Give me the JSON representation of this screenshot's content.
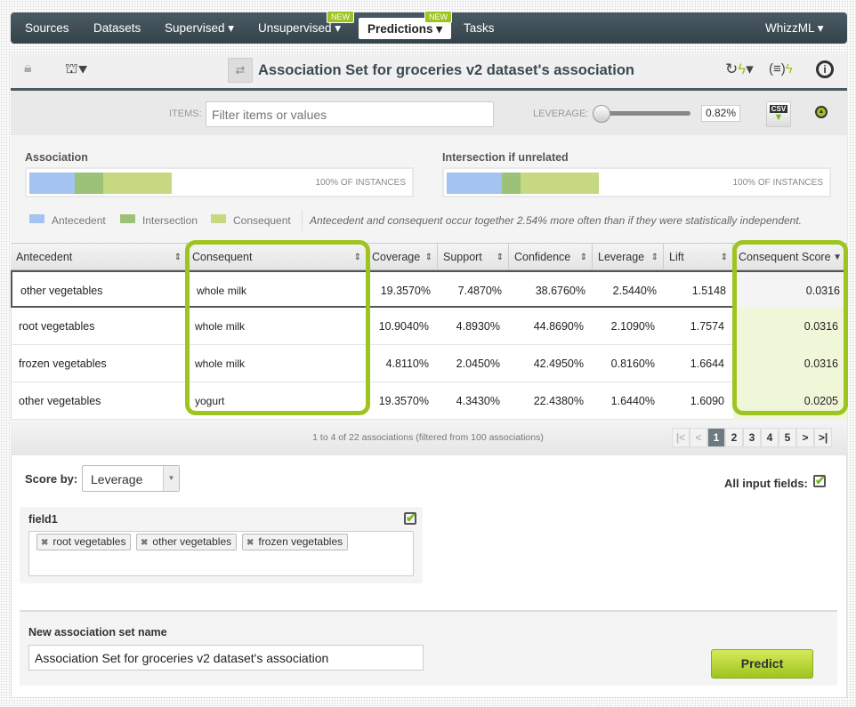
{
  "nav": {
    "items": [
      "Sources",
      "Datasets",
      "Supervised ▾",
      "Unsupervised ▾",
      "Predictions ▾",
      "Tasks"
    ],
    "new_badge": "NEW",
    "right": "WhizzML ▾"
  },
  "header": {
    "title": "Association Set for groceries v2 dataset's association"
  },
  "filter": {
    "items_label": "ITEMS:",
    "placeholder": "Filter items or values",
    "leverage_label": "LEVERAGE:",
    "leverage_value": "0.82%",
    "slider_fraction": 0,
    "csv": "CSV"
  },
  "summary": {
    "association_label": "Association",
    "intersection_label": "Intersection if unrelated",
    "instances": "100% OF INSTANCES",
    "legend": [
      "Antecedent",
      "Intersection",
      "Consequent"
    ],
    "colors": {
      "antecedent": "#a4c3f0",
      "intersection": "#9cc27a",
      "consequent": "#c6d980"
    },
    "note": "Antecedent and consequent occur together 2.54% more often than if they were statistically independent."
  },
  "table": {
    "columns": [
      "Antecedent",
      "Consequent",
      "Coverage",
      "Support",
      "Confidence",
      "Leverage",
      "Lift",
      "Consequent Score"
    ],
    "rows": [
      [
        "other vegetables",
        "whole milk",
        "19.3570%",
        "7.4870%",
        "38.6760%",
        "2.5440%",
        "1.5148",
        "0.0316"
      ],
      [
        "root vegetables",
        "whole milk",
        "10.9040%",
        "4.8930%",
        "44.8690%",
        "2.1090%",
        "1.7574",
        "0.0316"
      ],
      [
        "frozen vegetables",
        "whole milk",
        "4.8110%",
        "2.0450%",
        "42.4950%",
        "0.8160%",
        "1.6644",
        "0.0316"
      ],
      [
        "other vegetables",
        "yogurt",
        "19.3570%",
        "4.3430%",
        "22.4380%",
        "1.6440%",
        "1.6090",
        "0.0205"
      ]
    ],
    "footer": "1 to 4 of 22 associations (filtered from 100 associations)",
    "pages": [
      "1",
      "2",
      "3",
      "4",
      "5"
    ],
    "current_page": "1"
  },
  "form": {
    "score_by_label": "Score by:",
    "score_by_value": "Leverage",
    "all_input_label": "All input fields:",
    "field_name": "field1",
    "chips": [
      "root vegetables",
      "other vegetables",
      "frozen vegetables"
    ],
    "name_label": "New association set name",
    "name_value": "Association Set for groceries v2 dataset's association",
    "predict": "Predict"
  },
  "accent": "#9ec41f"
}
